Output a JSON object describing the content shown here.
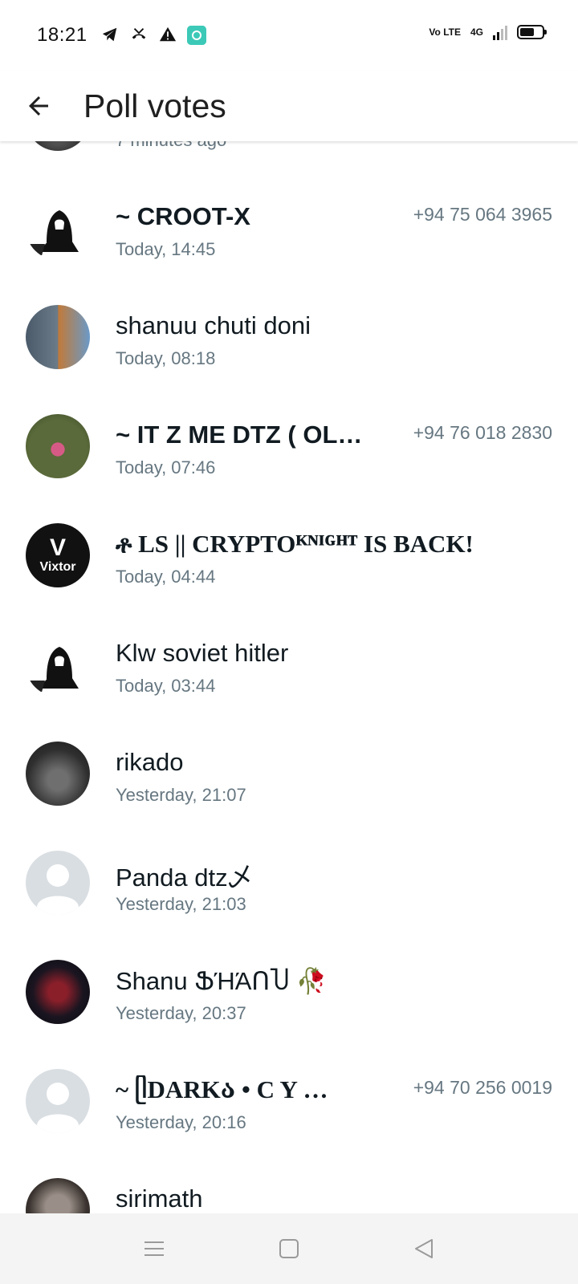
{
  "status_bar": {
    "time": "18:21",
    "icons": [
      "telegram-icon",
      "missed-call-icon",
      "warning-icon",
      "app-notification-icon"
    ],
    "volte_label": "Vo LTE",
    "network_label": "4G",
    "battery_level": 0.65
  },
  "app_bar": {
    "title": "Poll votes"
  },
  "partial_top_row": {
    "time": "7 minutes ago"
  },
  "voters": [
    {
      "name": "~ CROOT-X",
      "time": "Today, 14:45",
      "phone": "+94 75 064 3965",
      "avatar": "hacker-avatar"
    },
    {
      "name": "shanuu chuti doni",
      "time": "Today, 08:18",
      "phone": "",
      "avatar": "photo-avatar"
    },
    {
      "name": "~ IT  Z  ME   DTZ ( OL…",
      "time": "Today, 07:46",
      "phone": "+94 76 018 2830",
      "avatar": "photo-avatar"
    },
    {
      "name": "ቶ LS || CRYPTOᴷᴺᴵᴳᴴᵀ IS BACK!",
      "time": "Today, 04:44",
      "phone": "",
      "avatar": "vixtor-avatar",
      "avatar_text": "Vixtor"
    },
    {
      "name": "Klw soviet hitler",
      "time": "Today, 03:44",
      "phone": "",
      "avatar": "hacker-avatar"
    },
    {
      "name": "rikado",
      "time": "Yesterday, 21:07",
      "phone": "",
      "avatar": "photo-avatar"
    },
    {
      "name": "Panda dtz乄",
      "time": "Yesterday, 21:03",
      "phone": "",
      "avatar": "default-avatar"
    },
    {
      "name": "Shanu ՖΉΆՈႮ 🥀",
      "time": "Yesterday, 20:37",
      "phone": "",
      "avatar": "photo-avatar"
    },
    {
      "name": "~ ᥫDARKა  • C   Y …",
      "time": "Yesterday, 20:16",
      "phone": "+94 70 256 0019",
      "avatar": "default-avatar"
    },
    {
      "name": "sirimath",
      "time": "",
      "phone": "",
      "avatar": "photo-avatar"
    }
  ],
  "nav_bar": {
    "buttons": [
      "menu-icon",
      "home-icon",
      "back-icon"
    ]
  }
}
